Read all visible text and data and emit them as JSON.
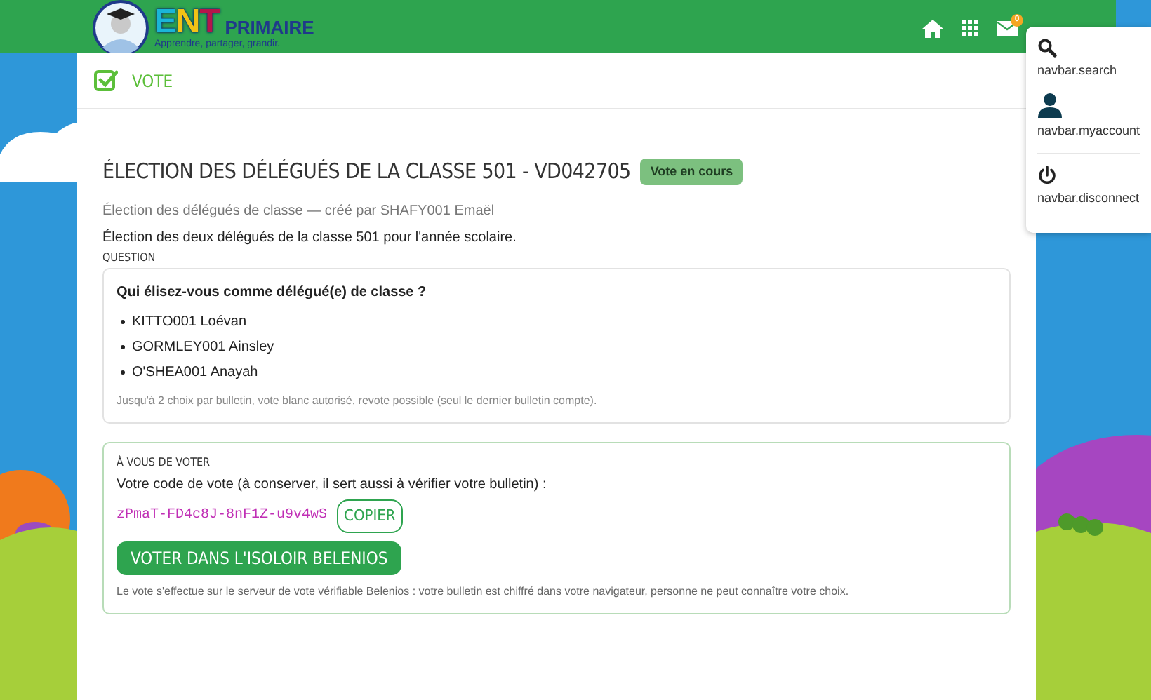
{
  "navbar": {
    "logo_mark": "ENT",
    "logo_name": "PRIMAIRE",
    "tagline": "Apprendre, partager, grandir.",
    "mail_badge": "0"
  },
  "menu": {
    "items": [
      {
        "kind": "search",
        "label": "navbar.search"
      },
      {
        "kind": "account",
        "label": "navbar.myaccount"
      },
      {
        "kind": "power",
        "label": "navbar.disconnect"
      }
    ]
  },
  "page_header": {
    "title": "VOTE"
  },
  "election": {
    "title": "ÉLECTION DES DÉLÉGUÉS DE LA CLASSE 501 - VD042705",
    "status": "Vote en cours",
    "meta": "Élection des délégués de classe — créé par SHAFY001 Emaël",
    "description": "Élection des deux délégués de la classe 501 pour l'année scolaire."
  },
  "question": {
    "section_label": "QUESTION",
    "text": "Qui élisez-vous comme délégué(e) de classe ?",
    "candidates": [
      "KITTO001 Loévan",
      "GORMLEY001 Ainsley",
      "O'SHEA001 Anayah"
    ],
    "rules": "Jusqu'à 2 choix par bulletin, vote blanc autorisé, revote possible (seul le dernier bulletin compte)."
  },
  "voting": {
    "section_label": "À VOUS DE VOTER",
    "code_label": "Votre code de vote (à conserver, il sert aussi à vérifier votre bulletin) :",
    "code": "zPmaT-FD4c8J-8nF1Z-u9v4wS",
    "copy_button": "COPIER",
    "vote_button": "VOTER DANS L'ISOLOIR BELENIOS",
    "footnote": "Le vote s'effectue sur le serveur de vote vérifiable Belenios : votre bulletin est chiffré dans votre navigateur, personne ne peut connaître votre choix."
  }
}
